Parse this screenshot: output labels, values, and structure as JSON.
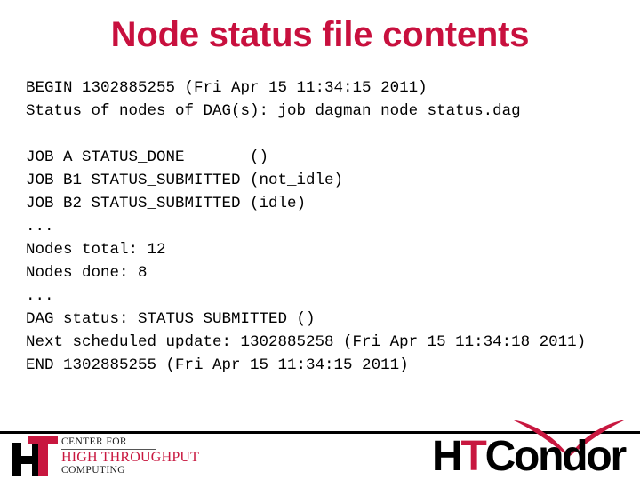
{
  "slide": {
    "title": "Node status file contents",
    "title_color": "#c8103e",
    "background_color": "#ffffff"
  },
  "file_contents": {
    "header_lines": [
      "BEGIN 1302885255 (Fri Apr 15 11:34:15 2011)",
      "Status of nodes of DAG(s): job_dagman_node_status.dag"
    ],
    "job_lines": [
      "JOB A STATUS_DONE       ()",
      "JOB B1 STATUS_SUBMITTED (not_idle)",
      "JOB B2 STATUS_SUBMITTED (idle)"
    ],
    "ellipsis_1": "...",
    "summary_lines": [
      "Nodes total: 12",
      "Nodes done: 8"
    ],
    "ellipsis_2": "...",
    "footer_lines": [
      "DAG status: STATUS_SUBMITTED ()",
      "Next scheduled update: 1302885258 (Fri Apr 15 11:34:18 2011)",
      "END 1302885255 (Fri Apr 15 11:34:15 2011)"
    ]
  },
  "footer": {
    "chtc_logo": {
      "mark_letters": "HT",
      "line1": "CENTER FOR",
      "line2": "HIGH THROUGHPUT",
      "line3": "COMPUTING",
      "black": "#1a1a1a",
      "red": "#c8173f"
    },
    "htcondor_logo": {
      "prefix_h": "H",
      "prefix_t": "T",
      "word": "Condor",
      "black": "#000000",
      "red": "#c8173f"
    }
  }
}
